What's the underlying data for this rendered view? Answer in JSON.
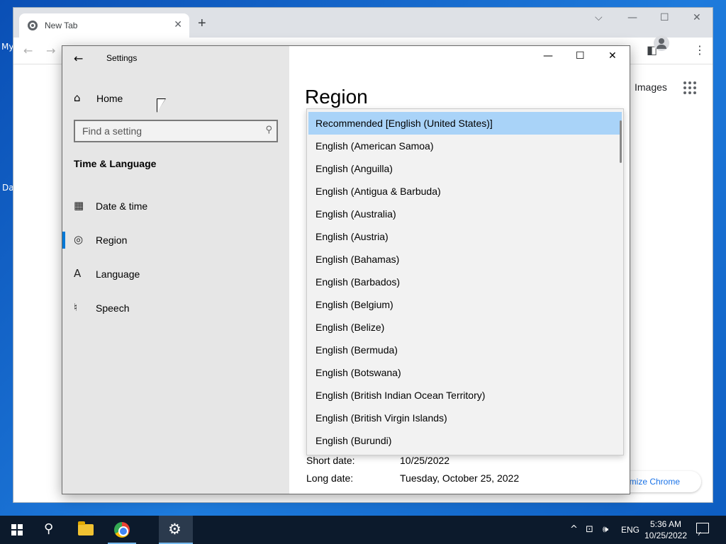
{
  "desktop": {
    "labels": [
      "My",
      "Da"
    ]
  },
  "chrome": {
    "tab_title": "New Tab",
    "tab_close": "✕",
    "new_tab": "+",
    "controls": {
      "dropdown": "⌵",
      "minimize": "—",
      "maximize": "☐",
      "close": "✕"
    },
    "nav": {
      "back": "←",
      "forward": "→"
    },
    "toolbar_icons": {
      "sidebar": "◧",
      "menu": "⋮"
    },
    "images_link": "Images",
    "customize_label": "omize Chrome"
  },
  "settings": {
    "app_title": "Settings",
    "back_icon": "←",
    "window_controls": {
      "minimize": "—",
      "maximize": "☐",
      "close": "✕"
    },
    "home_label": "Home",
    "home_icon": "⌂",
    "search_placeholder": "Find a setting",
    "search_icon": "⚲",
    "section_heading": "Time & Language",
    "nav_items": [
      {
        "label": "Date & time",
        "icon": "▦"
      },
      {
        "label": "Region",
        "icon": "◎"
      },
      {
        "label": "Language",
        "icon": "A"
      },
      {
        "label": "Speech",
        "icon": "♮"
      }
    ],
    "active_nav": "Region",
    "page_title": "Region",
    "dropdown_options": [
      "Recommended [English (United States)]",
      "English (American Samoa)",
      "English (Anguilla)",
      "English (Antigua & Barbuda)",
      "English (Australia)",
      "English (Austria)",
      "English (Bahamas)",
      "English (Barbados)",
      "English (Belgium)",
      "English (Belize)",
      "English (Bermuda)",
      "English (Botswana)",
      "English (British Indian Ocean Territory)",
      "English (British Virgin Islands)",
      "English (Burundi)"
    ],
    "selected_option": "Recommended [English (United States)]",
    "formats": [
      {
        "key": "Short date:",
        "value": "10/25/2022"
      },
      {
        "key": "Long date:",
        "value": "Tuesday, October 25, 2022"
      }
    ]
  },
  "taskbar": {
    "search_icon": "⚲",
    "settings_icon": "⚙",
    "tray_icons": {
      "chevron": "^",
      "network": "⊡",
      "volume": "🕪"
    },
    "language": "ENG",
    "time": "5:36 AM",
    "date": "10/25/2022"
  }
}
